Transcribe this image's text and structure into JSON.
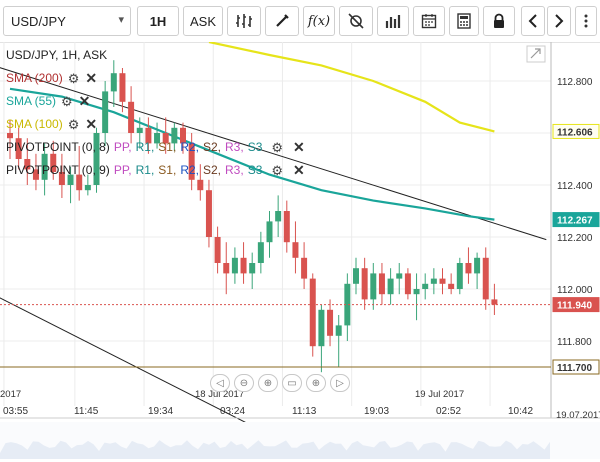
{
  "toolbar": {
    "symbol": "USD/JPY",
    "timeframe": "1H",
    "price_type": "ASK",
    "fx_label": "f(x)"
  },
  "legend": {
    "main": "USD/JPY, 1H, ASK",
    "sma200": "SMA (200)",
    "sma55": "SMA (55)",
    "sma100": "SMA (100)",
    "pivot1": {
      "name": "PIVOTPOINT (0, 8)",
      "levels": [
        "PP,",
        "R1,",
        "S1,",
        "R2,",
        "S2,",
        "R3,",
        "S3"
      ]
    },
    "pivot2": {
      "name": "PIVOTPOINT (0, 9)",
      "levels": [
        "PP,",
        "R1,",
        "S1,",
        "R2,",
        "S2,",
        "R3,",
        "S3"
      ]
    }
  },
  "colors": {
    "up": "#3aa57a",
    "down": "#d9534f",
    "sma55": "#1aa59a",
    "sma100": "#e6e41a",
    "sma200_text": "#b03030",
    "sma55_text": "#1aa59a",
    "sma100_text": "#c9b800",
    "pp": "#c04cc0",
    "r1": "#1a8a8a",
    "s1": "#8a5a20",
    "r2": "#1a50c0",
    "s2": "#6a3a20",
    "r3": "#c04cc0",
    "s3": "#1a8a8a"
  },
  "chart_data": {
    "type": "candlestick",
    "y_axis": {
      "min": 111.55,
      "max": 112.95,
      "ticks": [
        "112.800",
        "112.600",
        "112.400",
        "112.200",
        "112.000",
        "111.800"
      ]
    },
    "price_labels": [
      {
        "text": "112.606",
        "value": 112.606,
        "style": "sma100"
      },
      {
        "text": "112.267",
        "value": 112.267,
        "style": "sma55"
      },
      {
        "text": "111.940",
        "value": 111.94,
        "style": "current"
      },
      {
        "text": "111.700",
        "value": 111.7,
        "style": "pivot"
      }
    ],
    "x_ticks": [
      "03:55",
      "11:45",
      "19:34",
      "03:24",
      "11:13",
      "19:03",
      "02:52",
      "10:42"
    ],
    "date_labels": [
      "2017",
      "18 Jul 2017",
      "19 Jul 2017",
      "19.07.2017"
    ],
    "current_price": 111.94,
    "pivot_level": 111.7,
    "candles": [
      {
        "o": 112.6,
        "h": 112.65,
        "l": 112.5,
        "c": 112.58
      },
      {
        "o": 112.58,
        "h": 112.62,
        "l": 112.46,
        "c": 112.5
      },
      {
        "o": 112.5,
        "h": 112.58,
        "l": 112.4,
        "c": 112.46
      },
      {
        "o": 112.46,
        "h": 112.52,
        "l": 112.38,
        "c": 112.42
      },
      {
        "o": 112.42,
        "h": 112.56,
        "l": 112.36,
        "c": 112.52
      },
      {
        "o": 112.52,
        "h": 112.57,
        "l": 112.42,
        "c": 112.45
      },
      {
        "o": 112.45,
        "h": 112.52,
        "l": 112.35,
        "c": 112.4
      },
      {
        "o": 112.4,
        "h": 112.47,
        "l": 112.33,
        "c": 112.44
      },
      {
        "o": 112.44,
        "h": 112.55,
        "l": 112.34,
        "c": 112.38
      },
      {
        "o": 112.38,
        "h": 112.44,
        "l": 112.36,
        "c": 112.4
      },
      {
        "o": 112.4,
        "h": 112.62,
        "l": 112.37,
        "c": 112.6
      },
      {
        "o": 112.6,
        "h": 112.8,
        "l": 112.55,
        "c": 112.76
      },
      {
        "o": 112.76,
        "h": 112.88,
        "l": 112.7,
        "c": 112.83
      },
      {
        "o": 112.83,
        "h": 112.85,
        "l": 112.68,
        "c": 112.72
      },
      {
        "o": 112.72,
        "h": 112.78,
        "l": 112.56,
        "c": 112.6
      },
      {
        "o": 112.6,
        "h": 112.66,
        "l": 112.54,
        "c": 112.62
      },
      {
        "o": 112.62,
        "h": 112.66,
        "l": 112.52,
        "c": 112.56
      },
      {
        "o": 112.56,
        "h": 112.64,
        "l": 112.54,
        "c": 112.6
      },
      {
        "o": 112.6,
        "h": 112.66,
        "l": 112.52,
        "c": 112.56
      },
      {
        "o": 112.56,
        "h": 112.64,
        "l": 112.53,
        "c": 112.62
      },
      {
        "o": 112.62,
        "h": 112.64,
        "l": 112.52,
        "c": 112.56
      },
      {
        "o": 112.56,
        "h": 112.6,
        "l": 112.38,
        "c": 112.42
      },
      {
        "o": 112.42,
        "h": 112.48,
        "l": 112.34,
        "c": 112.38
      },
      {
        "o": 112.38,
        "h": 112.42,
        "l": 112.16,
        "c": 112.2
      },
      {
        "o": 112.2,
        "h": 112.24,
        "l": 112.06,
        "c": 112.1
      },
      {
        "o": 112.1,
        "h": 112.18,
        "l": 111.98,
        "c": 112.06
      },
      {
        "o": 112.06,
        "h": 112.16,
        "l": 112.02,
        "c": 112.12
      },
      {
        "o": 112.12,
        "h": 112.18,
        "l": 112.02,
        "c": 112.06
      },
      {
        "o": 112.06,
        "h": 112.14,
        "l": 112.0,
        "c": 112.1
      },
      {
        "o": 112.1,
        "h": 112.22,
        "l": 112.06,
        "c": 112.18
      },
      {
        "o": 112.18,
        "h": 112.3,
        "l": 112.12,
        "c": 112.26
      },
      {
        "o": 112.26,
        "h": 112.36,
        "l": 112.2,
        "c": 112.3
      },
      {
        "o": 112.3,
        "h": 112.34,
        "l": 112.14,
        "c": 112.18
      },
      {
        "o": 112.18,
        "h": 112.26,
        "l": 112.06,
        "c": 112.12
      },
      {
        "o": 112.12,
        "h": 112.18,
        "l": 112.0,
        "c": 112.04
      },
      {
        "o": 112.04,
        "h": 112.06,
        "l": 111.74,
        "c": 111.78
      },
      {
        "o": 111.78,
        "h": 111.94,
        "l": 111.68,
        "c": 111.92
      },
      {
        "o": 111.92,
        "h": 111.96,
        "l": 111.78,
        "c": 111.82
      },
      {
        "o": 111.82,
        "h": 111.9,
        "l": 111.7,
        "c": 111.86
      },
      {
        "o": 111.86,
        "h": 112.06,
        "l": 111.8,
        "c": 112.02
      },
      {
        "o": 112.02,
        "h": 112.12,
        "l": 111.98,
        "c": 112.08
      },
      {
        "o": 112.08,
        "h": 112.12,
        "l": 111.92,
        "c": 111.96
      },
      {
        "o": 111.96,
        "h": 112.1,
        "l": 111.92,
        "c": 112.06
      },
      {
        "o": 112.06,
        "h": 112.1,
        "l": 111.94,
        "c": 111.98
      },
      {
        "o": 111.98,
        "h": 112.08,
        "l": 111.94,
        "c": 112.04
      },
      {
        "o": 112.04,
        "h": 112.1,
        "l": 111.98,
        "c": 112.06
      },
      {
        "o": 112.06,
        "h": 112.08,
        "l": 111.96,
        "c": 111.98
      },
      {
        "o": 111.98,
        "h": 112.06,
        "l": 111.88,
        "c": 112.0
      },
      {
        "o": 112.0,
        "h": 112.06,
        "l": 111.96,
        "c": 112.02
      },
      {
        "o": 112.02,
        "h": 112.08,
        "l": 111.98,
        "c": 112.04
      },
      {
        "o": 112.04,
        "h": 112.08,
        "l": 111.98,
        "c": 112.02
      },
      {
        "o": 112.02,
        "h": 112.06,
        "l": 111.98,
        "c": 112.0
      },
      {
        "o": 112.0,
        "h": 112.12,
        "l": 111.98,
        "c": 112.1
      },
      {
        "o": 112.1,
        "h": 112.16,
        "l": 112.02,
        "c": 112.06
      },
      {
        "o": 112.06,
        "h": 112.14,
        "l": 112.0,
        "c": 112.12
      },
      {
        "o": 112.12,
        "h": 112.16,
        "l": 111.92,
        "c": 111.96
      },
      {
        "o": 111.96,
        "h": 112.02,
        "l": 111.9,
        "c": 111.94
      }
    ],
    "sma55": [
      {
        "i": 0,
        "v": 112.77
      },
      {
        "i": 6,
        "v": 112.74
      },
      {
        "i": 12,
        "v": 112.68
      },
      {
        "i": 18,
        "v": 112.6
      },
      {
        "i": 24,
        "v": 112.52
      },
      {
        "i": 30,
        "v": 112.44
      },
      {
        "i": 36,
        "v": 112.38
      },
      {
        "i": 42,
        "v": 112.34
      },
      {
        "i": 48,
        "v": 112.31
      },
      {
        "i": 53,
        "v": 112.28
      },
      {
        "i": 56,
        "v": 112.267
      }
    ],
    "sma100": [
      {
        "i": 23,
        "v": 112.95
      },
      {
        "i": 30,
        "v": 112.9
      },
      {
        "i": 36,
        "v": 112.86
      },
      {
        "i": 42,
        "v": 112.8
      },
      {
        "i": 48,
        "v": 112.72
      },
      {
        "i": 52,
        "v": 112.64
      },
      {
        "i": 56,
        "v": 112.606
      }
    ],
    "trendlines": [
      {
        "from": {
          "i": -2,
          "v": 112.86
        },
        "to": {
          "i": 62,
          "v": 112.19
        }
      },
      {
        "from": {
          "i": -2,
          "v": 111.98
        },
        "to": {
          "i": 30,
          "v": 111.44
        }
      }
    ]
  }
}
